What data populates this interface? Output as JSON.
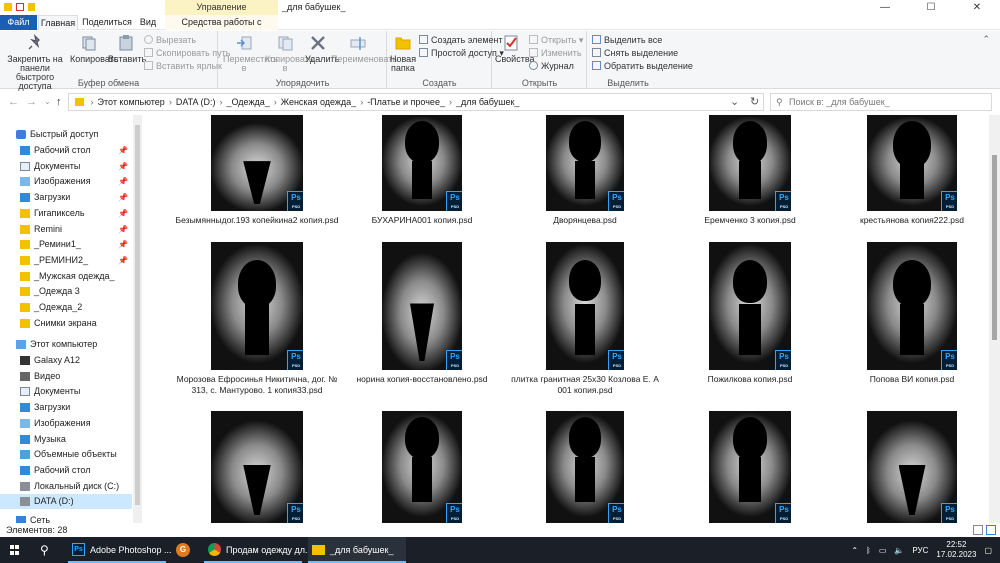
{
  "window": {
    "title": "_для бабушек_",
    "manage_tab": "Управление",
    "controls": {
      "minimize": "—",
      "maximize": "☐",
      "close": "✕"
    }
  },
  "tabs": {
    "file": "Файл",
    "home": "Главная",
    "share": "Поделиться",
    "view": "Вид",
    "picture_tools": "Средства работы с рисунками"
  },
  "ribbon": {
    "clipboard": {
      "label": "Буфер обмена",
      "pin": "Закрепить на панели быстрого доступа",
      "copy": "Копировать",
      "paste": "Вставить",
      "cut": "Вырезать",
      "copy_path": "Скопировать путь",
      "paste_shortcut": "Вставить ярлык"
    },
    "organize": {
      "label": "Упорядочить",
      "move_to": "Переместить в",
      "copy_to": "Копировать в",
      "delete": "Удалить",
      "rename": "Переименовать"
    },
    "new": {
      "label": "Создать",
      "new_folder": "Новая папка",
      "new_item": "Создать элемент",
      "easy_access": "Простой доступ"
    },
    "open": {
      "label": "Открыть",
      "properties": "Свойства",
      "open": "Открыть",
      "edit": "Изменить",
      "history": "Журнал"
    },
    "select": {
      "label": "Выделить",
      "select_all": "Выделить все",
      "select_none": "Снять выделение",
      "invert": "Обратить выделение"
    }
  },
  "address": {
    "crumbs": [
      "Этот компьютер",
      "DATA (D:)",
      "_Одежда_",
      "Женская одежда_",
      "-Платье и прочее_",
      "_для бабушек_"
    ],
    "search_placeholder": "Поиск в: _для бабушек_"
  },
  "sidebar": {
    "quick_access": "Быстрый доступ",
    "items": [
      {
        "label": "Рабочий стол",
        "pinned": true
      },
      {
        "label": "Документы",
        "pinned": true
      },
      {
        "label": "Изображения",
        "pinned": true
      },
      {
        "label": "Загрузки",
        "pinned": true
      },
      {
        "label": "Гигапиксель",
        "pinned": true
      },
      {
        "label": "Remini",
        "pinned": true
      },
      {
        "label": "_Ремини1_",
        "pinned": true
      },
      {
        "label": "_РЕМИНИ2_",
        "pinned": true
      },
      {
        "label": "_Мужская одежда_",
        "pinned": false
      },
      {
        "label": "_Одежда 3",
        "pinned": false
      },
      {
        "label": "_Одежда_2",
        "pinned": false
      },
      {
        "label": "Снимки экрана",
        "pinned": false
      }
    ],
    "this_pc": "Этот компьютер",
    "pc_items": [
      "Galaxy A12",
      "Видео",
      "Документы",
      "Загрузки",
      "Изображения",
      "Музыка",
      "Объемные объекты",
      "Рабочий стол",
      "Локальный диск (C:)",
      "DATA (D:)"
    ],
    "network": "Сеть"
  },
  "files": [
    {
      "name": "Безымянныдог.193 копейкина2 копия.psd",
      "variant": "collar"
    },
    {
      "name": "БУХАРИНА001 копия.psd",
      "variant": "person"
    },
    {
      "name": "Дворянцева.psd",
      "variant": "person"
    },
    {
      "name": "Еремченко 3 копия.psd",
      "variant": "person"
    },
    {
      "name": "крестьянова копия222.psd",
      "variant": "person"
    },
    {
      "name": "Морозова Ефросинья Никитична, дог. № 313, с. Мантурово. 1 копия33.psd",
      "variant": "person"
    },
    {
      "name": "норина копия-восстановлено.psd",
      "variant": "collar"
    },
    {
      "name": "плитка гранитная 25х30 Козлова Е. А 001 копия.psd",
      "variant": "person"
    },
    {
      "name": "Пожилкова копия.psd",
      "variant": "person"
    },
    {
      "name": "Попова ВИ копия.psd",
      "variant": "person"
    },
    {
      "name": "",
      "variant": "collar"
    },
    {
      "name": "",
      "variant": "person"
    },
    {
      "name": "",
      "variant": "person"
    },
    {
      "name": "",
      "variant": "person"
    },
    {
      "name": "",
      "variant": "collar"
    }
  ],
  "ps_badge": {
    "text": "Ps",
    "sub": "PSD"
  },
  "status": {
    "items_count": "Элементов: 28"
  },
  "taskbar": {
    "apps": [
      {
        "label": "Adobe Photoshop ..."
      },
      {
        "label": "Продам одежду дл..."
      },
      {
        "label": "_для бабушек_"
      }
    ],
    "language": "РУС",
    "time": "22:52",
    "date": "17.02.2023"
  }
}
